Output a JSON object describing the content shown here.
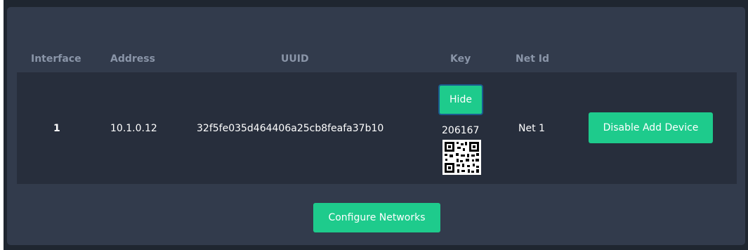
{
  "table": {
    "headers": {
      "interface": "Interface",
      "address": "Address",
      "uuid": "UUID",
      "key": "Key",
      "net_id": "Net Id"
    },
    "rows": [
      {
        "interface": "1",
        "address": "10.1.0.12",
        "uuid": "32f5fe035d464406a25cb8feafa37b10",
        "key": "206167",
        "net_id": "Net 1",
        "hide_label": "Hide",
        "disable_label": "Disable Add Device"
      }
    ]
  },
  "footer": {
    "configure_label": "Configure Networks"
  },
  "colors": {
    "panel": "#323b4c",
    "row": "#272e3c",
    "accent": "#1ecb8c",
    "header_text": "#8a95a8"
  }
}
